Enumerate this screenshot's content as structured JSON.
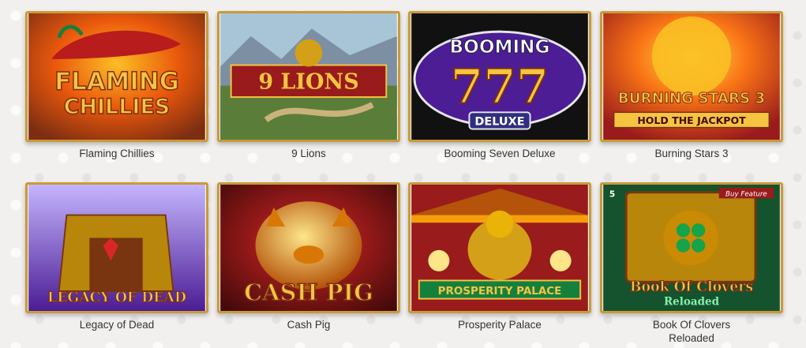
{
  "games": [
    {
      "title": "Flaming Chillies",
      "art_text_1": "FLAMING",
      "art_text_2": "CHILLIES",
      "colors": {
        "bg": "#c2410c",
        "text": "#f5c542"
      }
    },
    {
      "title": "9 Lions",
      "art_text_1": "9 LIONS",
      "art_text_2": "",
      "colors": {
        "bg": "#7f1d1d",
        "text": "#f5c542"
      }
    },
    {
      "title": "Booming Seven Deluxe",
      "art_text_1": "BOOMING",
      "art_text_2": "777",
      "art_text_3": "DELUXE",
      "colors": {
        "bg": "#3b0764",
        "text": "#ffffff"
      }
    },
    {
      "title": "Burning Stars 3",
      "art_text_1": "BURNING STARS 3",
      "art_text_2": "HOLD THE JACKPOT",
      "colors": {
        "bg": "#b91c1c",
        "text": "#f5c542"
      }
    },
    {
      "title": "Legacy of Dead",
      "art_text_1": "LEGACY OF DEAD",
      "art_text_2": "",
      "colors": {
        "bg": "#4c1d95",
        "text": "#f5c542"
      }
    },
    {
      "title": "Cash Pig",
      "art_text_1": "CASH PIG",
      "art_text_2": "",
      "colors": {
        "bg": "#7f1d1d",
        "text": "#f5c542"
      }
    },
    {
      "title": "Prosperity Palace",
      "art_text_1": "PROSPERITY PALACE",
      "art_text_2": "",
      "colors": {
        "bg": "#991b1b",
        "text": "#f5c542"
      }
    },
    {
      "title": "Book Of Clovers Reloaded",
      "art_text_1": "Book Of Clovers",
      "art_text_2": "Reloaded",
      "art_text_3": "Buy Feature",
      "art_text_4": "5",
      "colors": {
        "bg": "#14532d",
        "text": "#f5c542"
      }
    }
  ]
}
